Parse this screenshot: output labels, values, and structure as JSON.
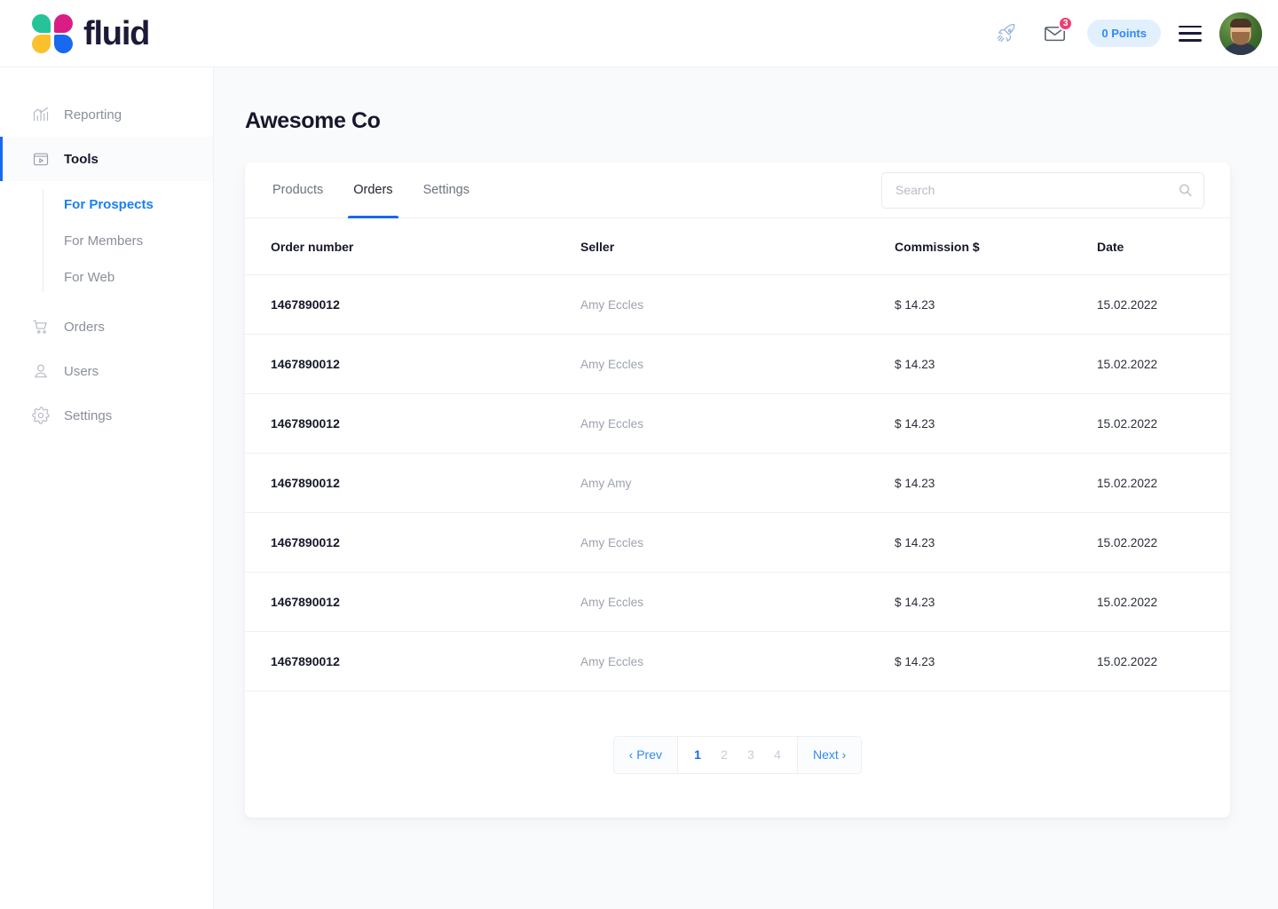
{
  "brand": {
    "name": "fluid"
  },
  "header": {
    "rocket_icon": "rocket-icon",
    "mail_icon": "mail-icon",
    "mail_badge": "3",
    "points_label": "0 Points",
    "menu_icon": "hamburger-icon",
    "avatar_alt": "user-avatar"
  },
  "sidebar": {
    "items": [
      {
        "label": "Reporting",
        "icon": "chart-icon",
        "active": false
      },
      {
        "label": "Tools",
        "icon": "tools-icon",
        "active": true
      },
      {
        "label": "Orders",
        "icon": "cart-icon",
        "active": false
      },
      {
        "label": "Users",
        "icon": "user-icon",
        "active": false
      },
      {
        "label": "Settings",
        "icon": "gear-icon",
        "active": false
      }
    ],
    "sub_items": [
      {
        "label": "For Prospects",
        "active": true
      },
      {
        "label": "For Members",
        "active": false
      },
      {
        "label": "For Web",
        "active": false
      }
    ]
  },
  "main": {
    "page_title": "Awesome Co",
    "tabs": [
      {
        "label": "Products",
        "active": false
      },
      {
        "label": "Orders",
        "active": true
      },
      {
        "label": "Settings",
        "active": false
      }
    ],
    "search": {
      "placeholder": "Search",
      "value": "",
      "icon": "search-icon"
    },
    "table": {
      "columns": [
        "Order number",
        "Seller",
        "Commission $",
        "Date"
      ],
      "rows": [
        {
          "order": "1467890012",
          "seller": "Amy Eccles",
          "commission": "$ 14.23",
          "date": "15.02.2022"
        },
        {
          "order": "1467890012",
          "seller": "Amy Eccles",
          "commission": "$ 14.23",
          "date": "15.02.2022"
        },
        {
          "order": "1467890012",
          "seller": "Amy Eccles",
          "commission": "$ 14.23",
          "date": "15.02.2022"
        },
        {
          "order": "1467890012",
          "seller": "Amy Amy",
          "commission": "$ 14.23",
          "date": "15.02.2022"
        },
        {
          "order": "1467890012",
          "seller": "Amy Eccles",
          "commission": "$ 14.23",
          "date": "15.02.2022"
        },
        {
          "order": "1467890012",
          "seller": "Amy Eccles",
          "commission": "$ 14.23",
          "date": "15.02.2022"
        },
        {
          "order": "1467890012",
          "seller": "Amy Eccles",
          "commission": "$ 14.23",
          "date": "15.02.2022"
        }
      ]
    },
    "pagination": {
      "prev_label": "‹ Prev",
      "next_label": "Next ›",
      "pages": [
        "1",
        "2",
        "3",
        "4"
      ],
      "current": "1"
    }
  },
  "colors": {
    "accent_blue": "#1769f0",
    "link_blue": "#2f8af5",
    "badge_pink": "#ef3e72",
    "text_dark": "#16182a",
    "text_muted": "#9da2ad",
    "page_bg": "#f9fafc"
  }
}
